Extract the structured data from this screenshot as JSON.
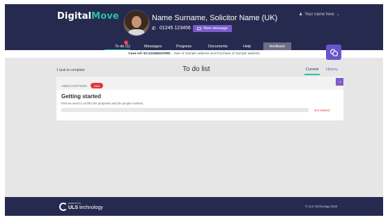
{
  "header": {
    "logo_part1": "Digital",
    "logo_part2": "Move",
    "solicitor_name": "Name Surname, Solicitor Name (UK)",
    "phone": "01245 123456",
    "new_message_label": "New message",
    "user_menu_label": "Your name here",
    "user_menu_caret": "⌄"
  },
  "nav": {
    "items": [
      {
        "label": "To do (1)"
      },
      {
        "label": "Messages"
      },
      {
        "label": "Progress"
      },
      {
        "label": "Documents"
      },
      {
        "label": "Help"
      }
    ],
    "todo_badge": "1",
    "feedback_label": "feedback"
  },
  "case_bar": {
    "ref": "Case ref: EC123456G/ORD",
    "description": "- Sale of Sample address and Purchase of Sample address"
  },
  "main": {
    "task_count": "1 task to complete",
    "title": "To do list",
    "tabs": [
      {
        "label": "Current"
      },
      {
        "label": "History"
      }
    ]
  },
  "task": {
    "added": "Added 01/07/2020",
    "badge": "New",
    "title": "Getting started",
    "description": "First we need to confirm the properties and the people involved.",
    "progress": 0,
    "status": "Not started",
    "arrow": "→"
  },
  "footer": {
    "powered_by": "powered by",
    "brand_bold": "ULS",
    "brand_rest": " technology",
    "copyright": "© ULS Technology 2020"
  },
  "colors": {
    "header_bg": "#272a4f",
    "accent_green": "#2bc0a7",
    "accent_purple": "#7c5ccc",
    "alert_red": "#e03a3a"
  },
  "icons": {
    "phone": "phone-icon",
    "user": "user-icon",
    "message": "message-icon",
    "arrow": "arrow-right-icon",
    "float": "chat-bubbles-icon"
  }
}
